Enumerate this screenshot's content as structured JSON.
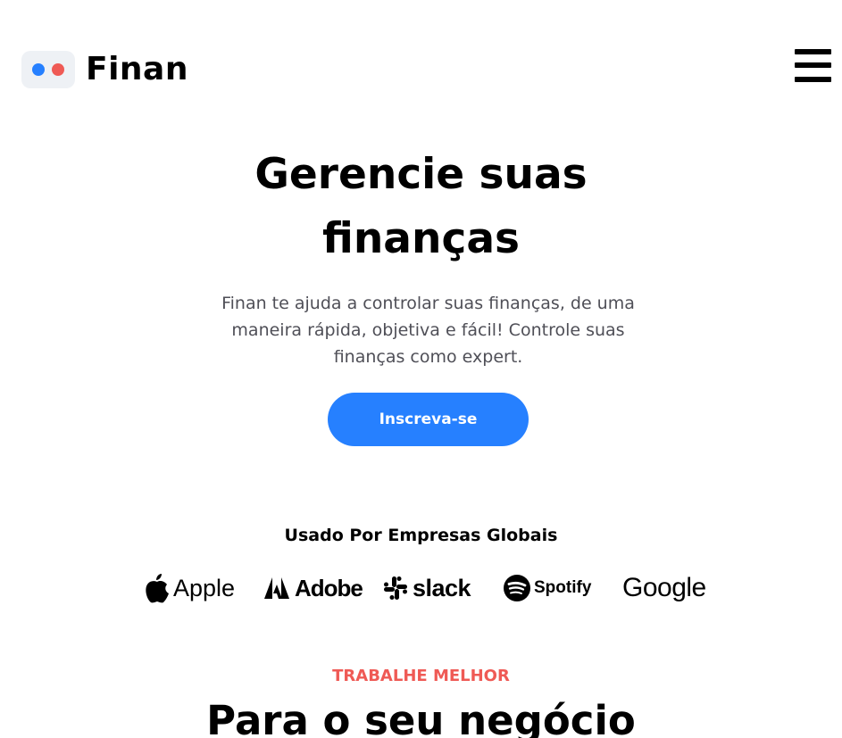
{
  "header": {
    "brand": "Finan",
    "logo_colors": [
      "#2680ff",
      "#ef5a55"
    ]
  },
  "hero": {
    "title_line1": "Gerencie suas",
    "title_line2": "finanças",
    "description": "Finan te ajuda a controlar suas finanças, de uma maneira rápida, objetiva e fácil! Controle suas finanças como expert.",
    "cta_label": "Inscreva-se",
    "accent_color": "#2680ff"
  },
  "brands": {
    "title": "Usado Por Empresas Globais",
    "logos": [
      {
        "name": "Apple",
        "icon": "apple-icon"
      },
      {
        "name": "Adobe",
        "icon": "adobe-icon"
      },
      {
        "name": "slack",
        "icon": "slack-icon"
      },
      {
        "name": "Spotify",
        "icon": "spotify-icon"
      },
      {
        "name": "Google",
        "icon": "google-wordmark"
      }
    ]
  },
  "section": {
    "eyebrow": "TRABALHE MELHOR",
    "title": "Para o seu negócio",
    "eyebrow_color": "#ef5a55"
  }
}
